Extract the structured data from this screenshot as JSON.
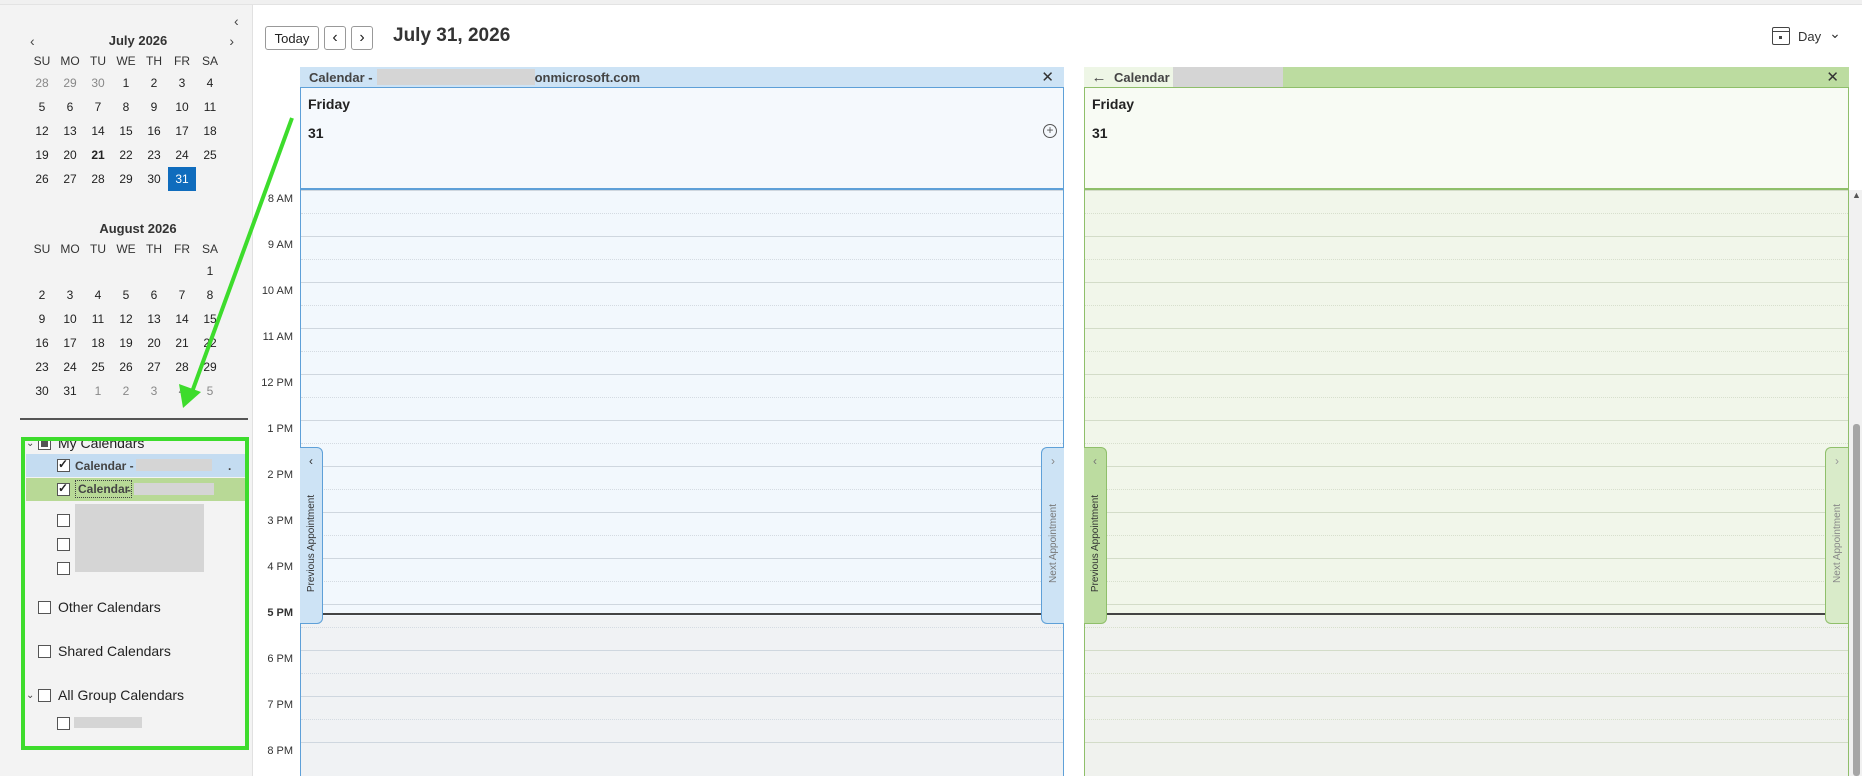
{
  "colors": {
    "accent": "#0f6cbd",
    "pane_blue": "#cde3f5",
    "pane_green": "#bcdca0",
    "annotation_green": "#3ddc2c"
  },
  "icons": {
    "collapse": "chevron-left-icon",
    "prev_month": "chevron-left-icon",
    "next_month": "chevron-right-icon",
    "view_switch": "calendar-icon",
    "close": "close-icon",
    "back": "arrow-left-icon",
    "add": "add-circle-icon"
  },
  "sidebar": {
    "collapse_glyph": "‹",
    "calendars": [
      {
        "title": "July 2026",
        "prev_glyph": "‹",
        "next_glyph": "›",
        "days": [
          "SU",
          "MO",
          "TU",
          "WE",
          "TH",
          "FR",
          "SA"
        ],
        "weeks": [
          [
            "28",
            "29",
            "30",
            "1",
            "2",
            "3",
            "4"
          ],
          [
            "5",
            "6",
            "7",
            "8",
            "9",
            "10",
            "11"
          ],
          [
            "12",
            "13",
            "14",
            "15",
            "16",
            "17",
            "18"
          ],
          [
            "19",
            "20",
            "21",
            "22",
            "23",
            "24",
            "25"
          ],
          [
            "26",
            "27",
            "28",
            "29",
            "30",
            "31",
            ""
          ]
        ]
      },
      {
        "title": "August 2026",
        "days": [
          "SU",
          "MO",
          "TU",
          "WE",
          "TH",
          "FR",
          "SA"
        ],
        "weeks": [
          [
            "",
            "",
            "",
            "",
            "",
            "",
            "1"
          ],
          [
            "2",
            "3",
            "4",
            "5",
            "6",
            "7",
            "8"
          ],
          [
            "9",
            "10",
            "11",
            "12",
            "13",
            "14",
            "15"
          ],
          [
            "16",
            "17",
            "18",
            "19",
            "20",
            "21",
            "22"
          ],
          [
            "23",
            "24",
            "25",
            "26",
            "27",
            "28",
            "29"
          ],
          [
            "30",
            "31",
            "1",
            "2",
            "3",
            "4",
            "5"
          ]
        ]
      }
    ],
    "groups": {
      "my_calendars": "My Calendars",
      "item1": "Calendar -",
      "item1_end": ".",
      "item2": "Calendar",
      "item2_sep": "-",
      "other": "Other Calendars",
      "shared": "Shared Calendars",
      "all_group": "All Group Calendars"
    }
  },
  "toolbar": {
    "today": "Today",
    "prev_glyph": "‹",
    "next_glyph": "›",
    "date": "July 31, 2026",
    "view": "Day",
    "view_chevron": "⌄"
  },
  "times": [
    "8 AM",
    "9 AM",
    "10 AM",
    "11 AM",
    "12 PM",
    "1 PM",
    "2 PM",
    "3 PM",
    "4 PM",
    "5 PM",
    "6 PM",
    "7 PM",
    "8 PM"
  ],
  "current_time": "5 PM",
  "panes": {
    "left": {
      "title_prefix": "Calendar -",
      "title_suffix": "onmicrosoft.com",
      "close_glyph": "✕",
      "day_name": "Friday",
      "day_num": "31",
      "add_glyph": "+",
      "prev_appt": "Previous Appointment",
      "next_appt": "Next Appointment",
      "prev_glyph": "‹",
      "next_glyph": "›"
    },
    "right": {
      "back_glyph": "←",
      "title": "Calendar",
      "close_glyph": "✕",
      "day_name": "Friday",
      "day_num": "31",
      "prev_appt": "Previous Appointment",
      "next_appt": "Next Appointment",
      "prev_glyph": "‹",
      "next_glyph": "›"
    }
  },
  "scroll_up_glyph": "▲"
}
